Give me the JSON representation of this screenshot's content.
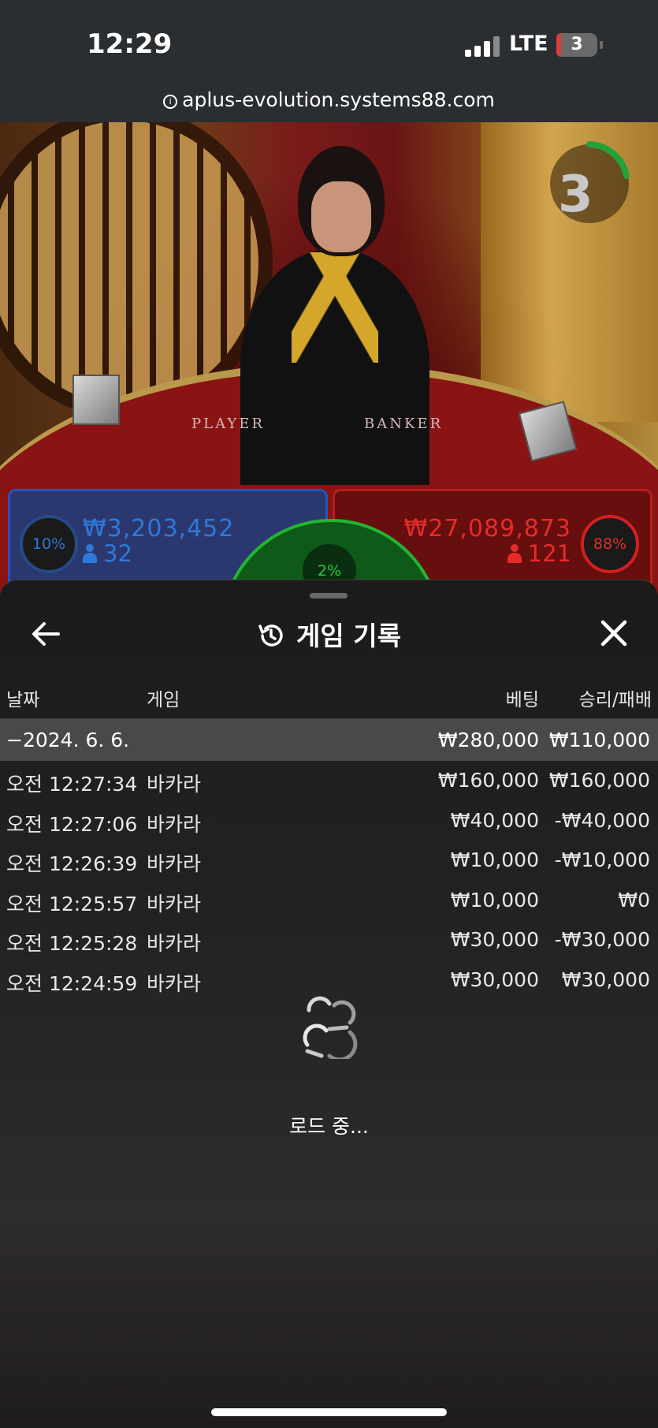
{
  "status_bar": {
    "time": "12:29",
    "network": "LTE",
    "battery": "3",
    "url": "aplus-evolution.systems88.com"
  },
  "game": {
    "timer": "3",
    "table_labels": {
      "player": "PLAYER",
      "banker": "BANKER"
    },
    "player": {
      "percent": "10%",
      "amount": "₩3,203,452",
      "players": "32",
      "color": "#2f79d8"
    },
    "banker": {
      "percent": "88%",
      "amount": "₩27,089,873",
      "players": "121",
      "color": "#e62b2b"
    },
    "tie": {
      "percent": "2%",
      "color": "#2ec846"
    }
  },
  "history": {
    "title": "게임 기록",
    "columns": {
      "date": "날짜",
      "game": "게임",
      "bet": "베팅",
      "result": "승리/패배"
    },
    "summary": {
      "date": "−2024. 6. 6.",
      "bet": "₩280,000",
      "result": "₩110,000"
    },
    "rows": [
      {
        "time": "오전 12:27:34",
        "game": "바카라",
        "bet": "₩160,000",
        "result": "₩160,000"
      },
      {
        "time": "오전 12:27:06",
        "game": "바카라",
        "bet": "₩40,000",
        "result": "-₩40,000"
      },
      {
        "time": "오전 12:26:39",
        "game": "바카라",
        "bet": "₩10,000",
        "result": "-₩10,000"
      },
      {
        "time": "오전 12:25:57",
        "game": "바카라",
        "bet": "₩10,000",
        "result": "₩0"
      },
      {
        "time": "오전 12:25:28",
        "game": "바카라",
        "bet": "₩30,000",
        "result": "-₩30,000"
      },
      {
        "time": "오전 12:24:59",
        "game": "바카라",
        "bet": "₩30,000",
        "result": "₩30,000"
      }
    ],
    "loading_text": "로드 중..."
  },
  "icons": {
    "back": "arrow-left-icon",
    "close": "close-icon",
    "history": "history-clock-icon",
    "spinner": "loading-spinner-icon"
  }
}
